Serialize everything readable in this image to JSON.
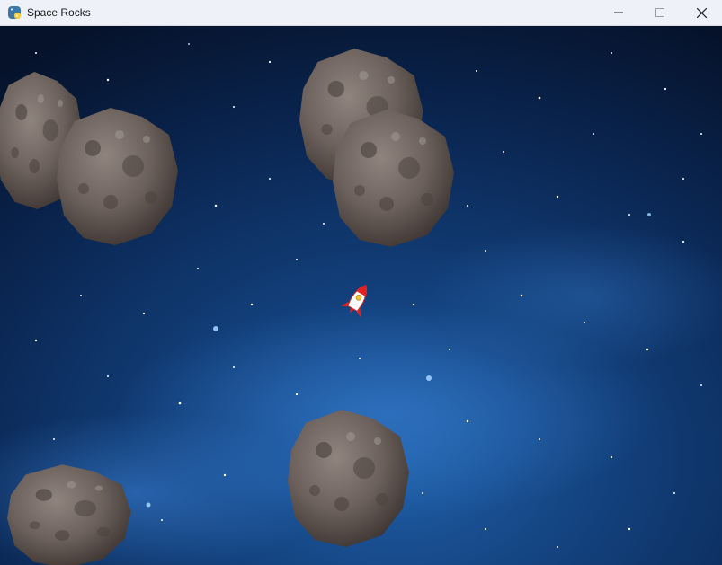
{
  "window": {
    "title": "Space Rocks",
    "app_icon": "python-icon",
    "controls": [
      "minimize-icon",
      "maximize-icon",
      "close-icon"
    ]
  },
  "game": {
    "background": "starfield-nebula",
    "colors": {
      "space_dark": "#06122a",
      "space_blue": "#1f5fa8",
      "rock": "#6b605b",
      "ship_red": "#e22222",
      "ship_white": "#ffffff"
    },
    "entities": [
      {
        "name": "spaceship",
        "icon": "rocket-icon"
      },
      {
        "name": "asteroid",
        "count": 6,
        "icon": "asteroid-icon"
      }
    ]
  }
}
